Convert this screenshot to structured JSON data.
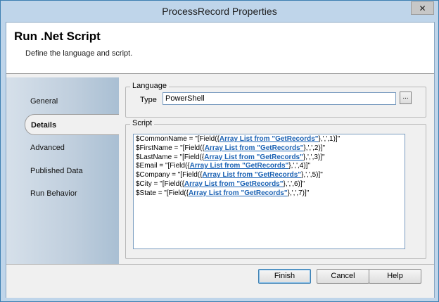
{
  "window": {
    "title": "ProcessRecord Properties",
    "close_symbol": "✕"
  },
  "header": {
    "title": "Run .Net Script",
    "subtitle": "Define the language and script."
  },
  "sidebar": {
    "items": [
      {
        "label": "General"
      },
      {
        "label": "Details"
      },
      {
        "label": "Advanced"
      },
      {
        "label": "Published Data"
      },
      {
        "label": "Run Behavior"
      }
    ],
    "selected": "Details"
  },
  "language": {
    "group_label": "Language",
    "type_label": "Type",
    "type_value": "PowerShell",
    "browse_label": "..."
  },
  "script": {
    "group_label": "Script",
    "lines": [
      {
        "prefix": "$CommonName = \"[Field({",
        "link": "Array List from \"GetRecords\"",
        "suffix": "},',',1)]\""
      },
      {
        "prefix": "$FirstName = \"[Field({",
        "link": "Array List from \"GetRecords\"",
        "suffix": "},',',2)]\""
      },
      {
        "prefix": "$LastName = \"[Field({",
        "link": "Array List from \"GetRecords\"",
        "suffix": "},',',3)]\""
      },
      {
        "prefix": "$Email = \"[Field({",
        "link": "Array List from \"GetRecords\"",
        "suffix": "},',',4)]\""
      },
      {
        "prefix": "$Company = \"[Field({",
        "link": "Array List from \"GetRecords\"",
        "suffix": "},',',5)]\""
      },
      {
        "prefix": "$City = \"[Field({",
        "link": "Array List from \"GetRecords\"",
        "suffix": "},',',6)]\""
      },
      {
        "prefix": "$State = \"[Field({",
        "link": "Array List from \"GetRecords\"",
        "suffix": "},',',7)]\""
      }
    ]
  },
  "footer": {
    "finish_label": "Finish",
    "cancel_label": "Cancel",
    "help_label": "Help"
  }
}
